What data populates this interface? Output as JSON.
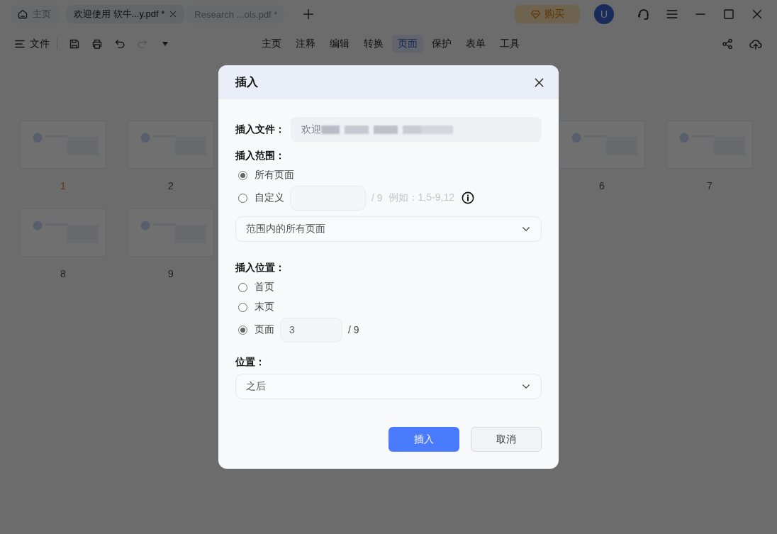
{
  "title_bar": {
    "home_tab": {
      "label": "主页",
      "selected": false
    },
    "document_tabs": [
      {
        "label": "欢迎使用 软牛...y.pdf *",
        "selected": true
      },
      {
        "label": "Research ...ols.pdf *",
        "selected": false
      }
    ],
    "buy_button": "购买",
    "avatar_letter": "U"
  },
  "toolbar": {
    "file_menu": "文件",
    "undo": {
      "disabled": false
    },
    "redo": {
      "disabled": true
    },
    "menu_tabs": [
      {
        "label": "主页",
        "selected": false
      },
      {
        "label": "注释",
        "selected": false
      },
      {
        "label": "编辑",
        "selected": false
      },
      {
        "label": "转换",
        "selected": false
      },
      {
        "label": "页面",
        "selected": true
      },
      {
        "label": "保护",
        "selected": false
      },
      {
        "label": "表单",
        "selected": false
      },
      {
        "label": "工具",
        "selected": false
      }
    ]
  },
  "thumbnails": [
    {
      "label": "1",
      "selected": true
    },
    {
      "label": "2",
      "selected": false
    },
    {
      "label": "6",
      "selected": false
    },
    {
      "label": "7",
      "selected": false
    },
    {
      "label": "8",
      "selected": false
    },
    {
      "label": "9",
      "selected": false
    }
  ],
  "dialog": {
    "title": "插入",
    "file_label": "插入文件：",
    "file_value": "欢迎",
    "range_label": "插入范围：",
    "range_options": [
      {
        "kind": "plain",
        "label": "所有页面",
        "selected": true
      },
      {
        "kind": "custom",
        "label": "自定义",
        "selected": false,
        "total": "/ 9",
        "hint": "例如：1,5-9,12"
      }
    ],
    "range_select": "范围内的所有页面",
    "position_label": "插入位置：",
    "position_options": [
      {
        "kind": "plain",
        "label": "首页",
        "selected": false
      },
      {
        "kind": "plain",
        "label": "末页",
        "selected": false
      },
      {
        "kind": "page",
        "label": "页面",
        "selected": true,
        "value": "3",
        "total": "/ 9"
      }
    ],
    "placement_label": "位置：",
    "placement_select": "之后",
    "buttons": [
      {
        "kind": "primary",
        "label": "插入"
      },
      {
        "kind": "secondary",
        "label": "取消"
      }
    ]
  }
}
